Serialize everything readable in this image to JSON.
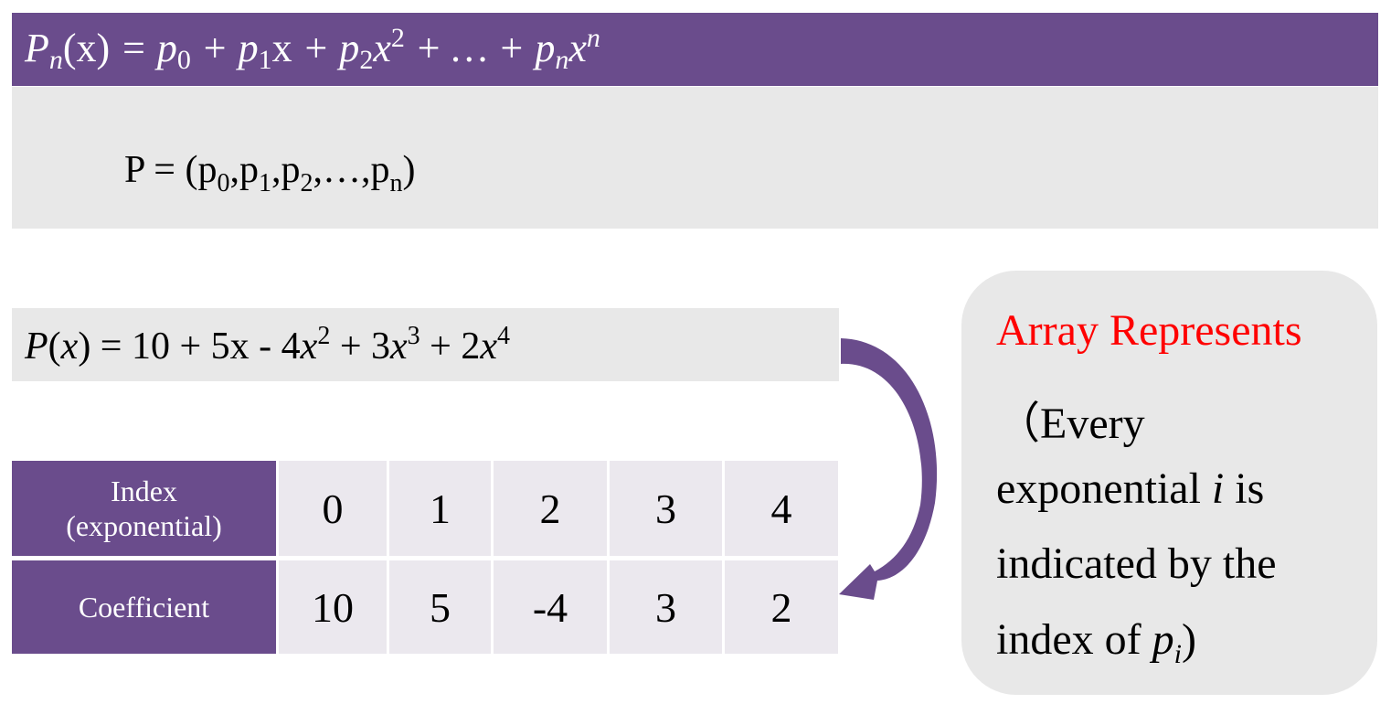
{
  "general_formula": {
    "P": "P",
    "sub_n": "n",
    "x_lhs": "(x)",
    "eq_p0": " = p",
    "sub_0": "0",
    "plus_p1": " + p",
    "sub_1": "1",
    "x1": "x",
    "plus_p2": " + p",
    "sub_2": "2",
    "x2": "x",
    "sup_2": "2",
    "dots": " + … + p",
    "sub_last": "n",
    "xn": "x",
    "sup_n": "n"
  },
  "vector": {
    "prefix": "P = (p",
    "s0": "0",
    "c1": ",p",
    "s1": "1",
    "c2": ",p",
    "s2": "2",
    "c3": ",…,p",
    "sn": "n",
    "close": ")"
  },
  "example": {
    "P": "P",
    "x_paren_open": "(",
    "x": "x",
    "rest1": ") = 10 + 5x - 4",
    "x2": "x",
    "sup2": "2",
    "rest2": " + 3",
    "x3": "x",
    "sup3": "3",
    "rest3": " + 2",
    "x4": "x",
    "sup4": "4"
  },
  "table": {
    "index_header_line1": "Index",
    "index_header_line2": "(exponential)",
    "coefficient_header": "Coefficient",
    "indices": [
      "0",
      "1",
      "2",
      "3",
      "4"
    ],
    "coefficients": [
      "10",
      "5",
      "-4",
      "3",
      "2"
    ]
  },
  "note": {
    "title": "Array Represents",
    "line1": "（Every",
    "line2a": "exponential ",
    "line2i": "i",
    "line2b": " is",
    "line3": "indicated by the",
    "line4a": "index of ",
    "line4p": "p",
    "line4sub": "i",
    "line4b": ")"
  },
  "colors": {
    "accent_purple": "#6a4c8c",
    "panel_gray": "#e8e8e8",
    "cell_gray": "#ebe8ee",
    "title_red": "#ff0000"
  }
}
